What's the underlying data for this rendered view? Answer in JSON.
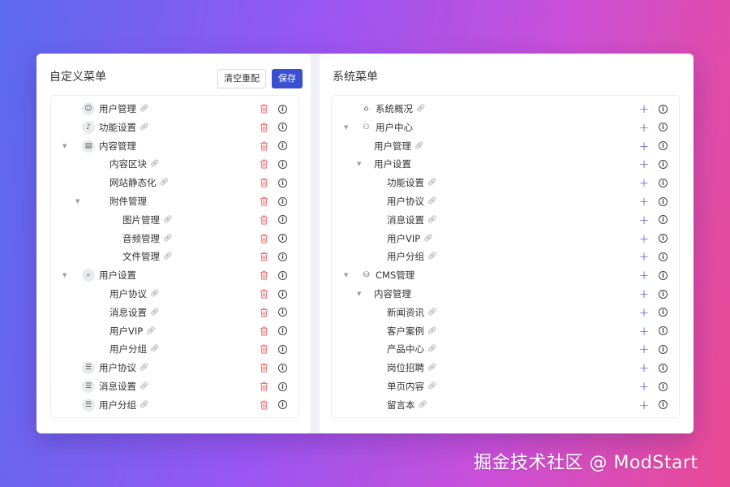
{
  "custom_menu": {
    "title": "自定义菜单",
    "reset_label": "清空重配",
    "save_label": "保存",
    "items": [
      {
        "label": "用户管理",
        "icon": "smile-icon",
        "caret": false,
        "link": true
      },
      {
        "label": "功能设置",
        "icon": "tiktok-icon",
        "caret": false,
        "link": true
      },
      {
        "label": "内容管理",
        "icon": "document-icon",
        "caret": true,
        "link": false
      },
      {
        "label": "内容区块",
        "icon": "",
        "caret": false,
        "link": true
      },
      {
        "label": "网站静态化",
        "icon": "",
        "caret": false,
        "link": true
      },
      {
        "label": "附件管理",
        "icon": "",
        "caret": true,
        "link": false
      },
      {
        "label": "图片管理",
        "icon": "",
        "caret": false,
        "link": true
      },
      {
        "label": "音频管理",
        "icon": "",
        "caret": false,
        "link": true
      },
      {
        "label": "文件管理",
        "icon": "",
        "caret": false,
        "link": true
      },
      {
        "label": "用户设置",
        "icon": "search-icon",
        "caret": true,
        "link": false
      },
      {
        "label": "用户协议",
        "icon": "",
        "caret": false,
        "link": true
      },
      {
        "label": "消息设置",
        "icon": "",
        "caret": false,
        "link": true
      },
      {
        "label": "用户VIP",
        "icon": "",
        "caret": false,
        "link": true
      },
      {
        "label": "用户分组",
        "icon": "",
        "caret": false,
        "link": true
      },
      {
        "label": "用户协议",
        "icon": "list-icon",
        "caret": false,
        "link": true
      },
      {
        "label": "消息设置",
        "icon": "list-icon",
        "caret": false,
        "link": true
      },
      {
        "label": "用户分组",
        "icon": "list-icon",
        "caret": false,
        "link": true
      }
    ]
  },
  "system_menu": {
    "title": "系统菜单",
    "items": [
      {
        "label": "系统概况",
        "icon": "home-icon",
        "caret": false,
        "link": true
      },
      {
        "label": "用户中心",
        "icon": "users-icon",
        "caret": true,
        "link": false
      },
      {
        "label": "用户管理",
        "icon": "",
        "caret": false,
        "link": true
      },
      {
        "label": "用户设置",
        "icon": "",
        "caret": true,
        "link": false
      },
      {
        "label": "功能设置",
        "icon": "",
        "caret": false,
        "link": true
      },
      {
        "label": "用户协议",
        "icon": "",
        "caret": false,
        "link": true
      },
      {
        "label": "消息设置",
        "icon": "",
        "caret": false,
        "link": true
      },
      {
        "label": "用户VIP",
        "icon": "",
        "caret": false,
        "link": true
      },
      {
        "label": "用户分组",
        "icon": "",
        "caret": false,
        "link": true
      },
      {
        "label": "CMS管理",
        "icon": "database-icon",
        "caret": true,
        "link": false
      },
      {
        "label": "内容管理",
        "icon": "",
        "caret": true,
        "link": false
      },
      {
        "label": "新闻资讯",
        "icon": "",
        "caret": false,
        "link": true
      },
      {
        "label": "客户案例",
        "icon": "",
        "caret": false,
        "link": true
      },
      {
        "label": "产品中心",
        "icon": "",
        "caret": false,
        "link": true
      },
      {
        "label": "岗位招聘",
        "icon": "",
        "caret": false,
        "link": true
      },
      {
        "label": "单页内容",
        "icon": "",
        "caret": false,
        "link": true
      },
      {
        "label": "留言本",
        "icon": "",
        "caret": false,
        "link": true
      }
    ]
  },
  "watermark": "掘金技术社区 @ ModStart",
  "colors": {
    "accent": "#3b4fd1",
    "delete": "#f07a7a"
  }
}
